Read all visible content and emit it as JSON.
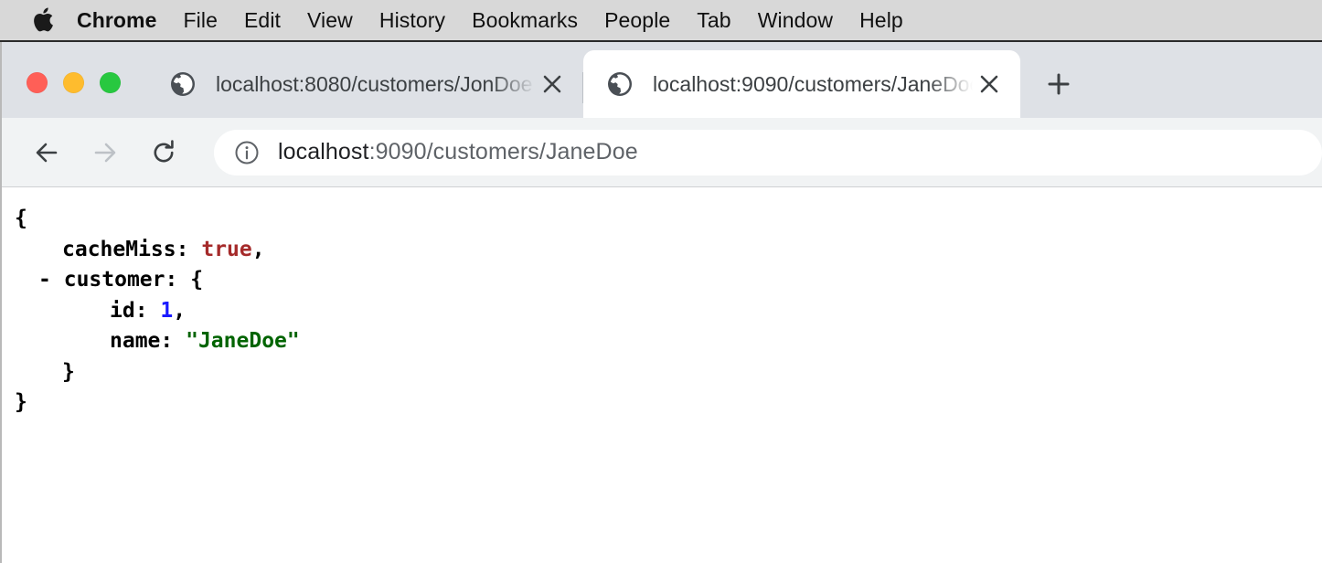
{
  "menubar": {
    "apple_icon": "apple-logo-icon",
    "items": [
      {
        "label": "Chrome",
        "bold": true
      },
      {
        "label": "File",
        "bold": false
      },
      {
        "label": "Edit",
        "bold": false
      },
      {
        "label": "View",
        "bold": false
      },
      {
        "label": "History",
        "bold": false
      },
      {
        "label": "Bookmarks",
        "bold": false
      },
      {
        "label": "People",
        "bold": false
      },
      {
        "label": "Tab",
        "bold": false
      },
      {
        "label": "Window",
        "bold": false
      },
      {
        "label": "Help",
        "bold": false
      }
    ]
  },
  "window_controls": {
    "close_color": "#ff5f57",
    "minimize_color": "#febc2e",
    "zoom_color": "#28c840"
  },
  "tabstrip": {
    "tabs": [
      {
        "title": "localhost:8080/customers/JonDoe",
        "favicon": "globe-icon",
        "close_label": "✕",
        "active": false
      },
      {
        "title": "localhost:9090/customers/JaneDoe",
        "favicon": "globe-icon",
        "close_label": "✕",
        "active": true
      }
    ],
    "new_tab_label": "+"
  },
  "toolbar": {
    "back_icon": "back-arrow-icon",
    "forward_icon": "forward-arrow-icon",
    "reload_icon": "reload-icon",
    "omnibox": {
      "info_icon": "info-circle-icon",
      "host": "localhost",
      "rest": ":9090/customers/JaneDoe",
      "full_url": "localhost:9090/customers/JaneDoe"
    }
  },
  "page": {
    "viewer": "json-viewer",
    "lines": [
      {
        "indent": 0,
        "toggle": "",
        "text": "{",
        "parts": [
          {
            "t": "{",
            "c": "punct"
          }
        ]
      },
      {
        "indent": 0,
        "toggle": "",
        "text": "cacheMiss: true,",
        "parts": []
      },
      {
        "indent": 0,
        "toggle": "-",
        "text": "customer: {",
        "parts": []
      },
      {
        "indent": 0,
        "toggle": "",
        "text": "id: 1,",
        "parts": []
      },
      {
        "indent": 0,
        "toggle": "",
        "text": "name: \"JaneDoe\"",
        "parts": []
      },
      {
        "indent": 0,
        "toggle": "",
        "text": "}",
        "parts": []
      },
      {
        "indent": 0,
        "toggle": "",
        "text": "}",
        "parts": []
      }
    ],
    "json_text": {
      "open_brace": "{",
      "key_cachemiss": "cacheMiss:",
      "value_cachemiss": "true",
      "comma1": ",",
      "toggle_customer": "-",
      "key_customer": "customer:",
      "open_brace2": "{",
      "key_id": "id:",
      "value_id": "1",
      "comma2": ",",
      "key_name": "name:",
      "value_name": "\"JaneDoe\"",
      "close_brace2": "}",
      "close_brace": "}"
    },
    "colors": {
      "boolean": "#a52a2a",
      "number": "#1a1aff",
      "string": "#006400",
      "key": "#000000"
    }
  }
}
